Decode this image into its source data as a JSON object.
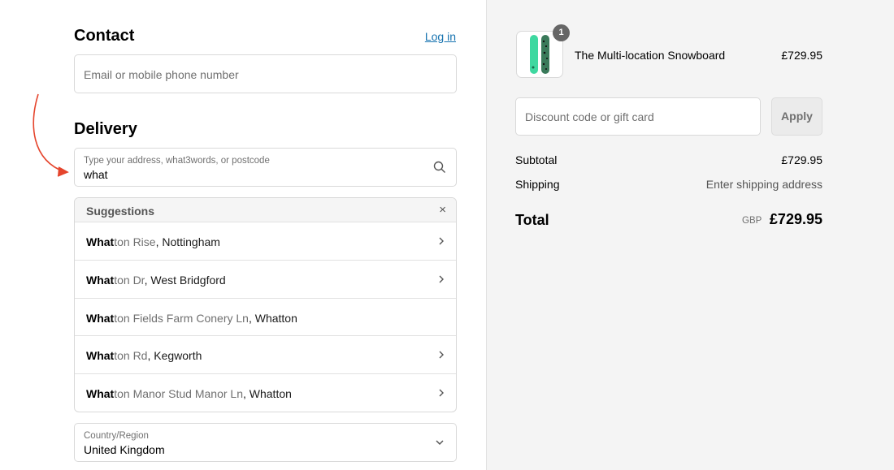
{
  "contact": {
    "heading": "Contact",
    "login_label": "Log in",
    "email_placeholder": "Email or mobile phone number"
  },
  "delivery": {
    "heading": "Delivery",
    "address_label": "Type your address, what3words, or postcode",
    "address_value": "what",
    "search_icon": "search-icon"
  },
  "suggestions": {
    "heading": "Suggestions",
    "close_label": "×",
    "items": [
      {
        "match": "What",
        "rest": "ton Rd",
        "sep": "",
        "area": "Kegworth"
      },
      {
        "match": "What",
        "rest": "ton Rise",
        "area": "Nottingham",
        "chevron": true
      },
      {
        "match": "What",
        "rest": "ton Dr",
        "area": "West Bridgford",
        "chevron": true
      },
      {
        "match": "What",
        "rest": "ton Fields Farm Conery Ln",
        "area": "Whatton",
        "chevron": false
      },
      {
        "match": "What",
        "rest": "ton Rd",
        "area": "Kegworth",
        "chevron": true
      },
      {
        "match": "What",
        "rest": "ton Manor Stud Manor Ln",
        "area": "Whatton",
        "chevron": true
      }
    ]
  },
  "country": {
    "label": "Country/Region",
    "value": "United Kingdom"
  },
  "summary": {
    "product_name": "The Multi-location Snowboard",
    "product_price": "£729.95",
    "quantity": "1",
    "discount_placeholder": "Discount code or gift card",
    "apply_label": "Apply",
    "subtotal_label": "Subtotal",
    "subtotal_value": "£729.95",
    "shipping_label": "Shipping",
    "shipping_value": "Enter shipping address",
    "total_label": "Total",
    "total_currency": "GBP",
    "total_value": "£729.95"
  },
  "colors": {
    "accent_link": "#1773b0",
    "arrow": "#e5452d",
    "snowboard_green": "#3ed8a0"
  }
}
